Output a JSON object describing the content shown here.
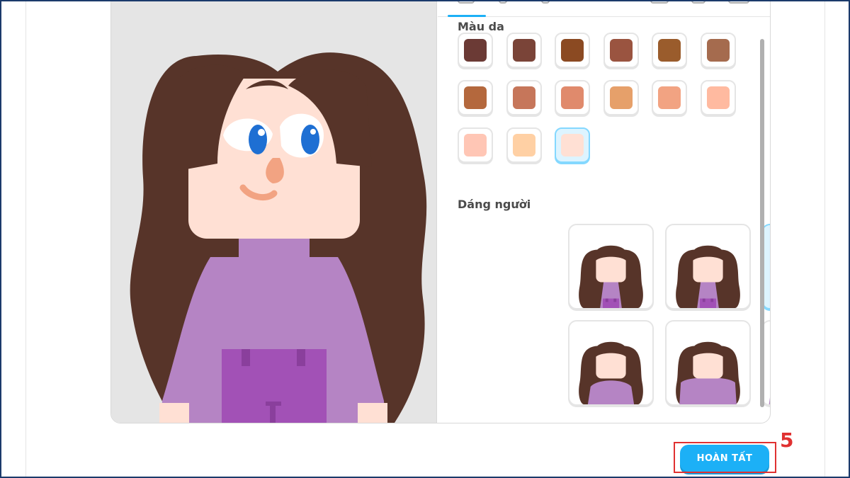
{
  "skin_section": {
    "title": "Màu da",
    "colors": [
      "#6b3a35",
      "#7a4438",
      "#8b4a22",
      "#9a5440",
      "#9a5c2c",
      "#a56b4e",
      "#b4683d",
      "#c6765a",
      "#e08a6c",
      "#e6a06a",
      "#f2a382",
      "#ffbaa0",
      "#ffc6b5",
      "#ffd0a4",
      "#ffe0d4"
    ],
    "selected_index": 14
  },
  "body_section": {
    "title": "Dáng người",
    "options": [
      "body-1",
      "body-2",
      "body-3",
      "body-4",
      "body-5",
      "body-6"
    ],
    "selected_index": 2
  },
  "footer": {
    "finish_label": "HOÀN TẤT",
    "step_annotation": "5"
  },
  "colors": {
    "accent": "#1cb0f6",
    "hair": "#573429",
    "shirt": "#b584c4",
    "skin": "#ffe0d4",
    "annotation": "#e03131"
  }
}
